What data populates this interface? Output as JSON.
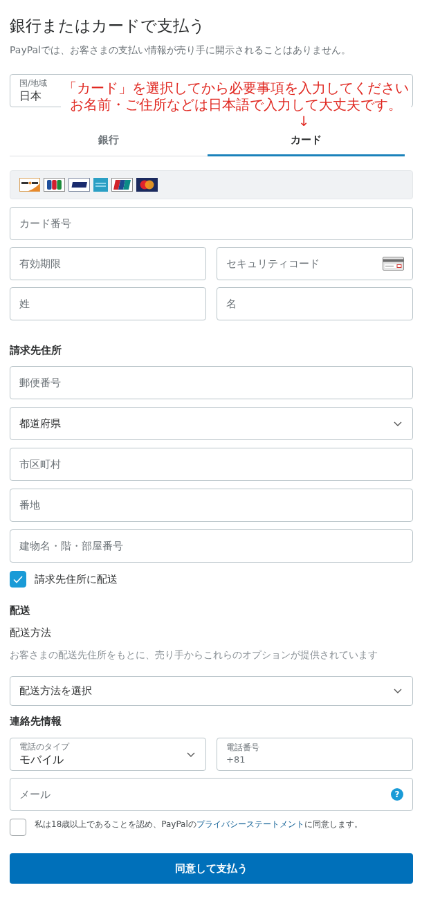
{
  "header": {
    "title": "銀行またはカードで支払う",
    "subtitle": "PayPalでは、お客さまの支払い情報が売り手に開示されることはありません。"
  },
  "country": {
    "label": "国/地域",
    "value": "日本"
  },
  "annotation": {
    "lines": [
      "「カード」を選択してから必要事項を入力してください",
      "お名前・ご住所などは日本語で入力して大丈夫です。"
    ],
    "arrow": "↓"
  },
  "tabs": [
    {
      "label": "銀行",
      "selected": false
    },
    {
      "label": "カード",
      "selected": true
    }
  ],
  "card_form": {
    "rows": [
      [
        {
          "kind": "text",
          "placeholder": "カード番号"
        }
      ],
      [
        {
          "kind": "text",
          "placeholder": "有効期限"
        },
        {
          "kind": "card_code",
          "placeholder": "セキュリティコード"
        }
      ],
      [
        {
          "kind": "text",
          "placeholder": "姓"
        },
        {
          "kind": "text",
          "placeholder": "名"
        }
      ]
    ]
  },
  "billing": {
    "heading": "請求先住所",
    "rows": [
      [
        {
          "kind": "text",
          "placeholder": "郵便番号"
        }
      ],
      [
        {
          "kind": "select",
          "value": "都道府県"
        }
      ],
      [
        {
          "kind": "text",
          "placeholder": "市区町村"
        }
      ],
      [
        {
          "kind": "text",
          "placeholder": "番地"
        }
      ],
      [
        {
          "kind": "text",
          "placeholder": "建物名・階・部屋番号"
        }
      ]
    ],
    "ship_to_billing": {
      "label": "請求先住所に配送",
      "checked": true
    }
  },
  "shipping": {
    "heading": "配送",
    "method_label": "配送方法",
    "hint": "お客さまの配送先住所をもとに、売り手からこれらのオプションが提供されています",
    "select": {
      "kind": "select",
      "value": "配送方法を選択"
    }
  },
  "contact": {
    "heading": "連絡先情報",
    "rows": [
      [
        {
          "kind": "labeled_select",
          "label": "電話のタイプ",
          "value": "モバイル"
        },
        {
          "kind": "labeled_text",
          "label": "電話番号",
          "value": "+81"
        }
      ],
      [
        {
          "kind": "help",
          "placeholder": "メール",
          "help": "?"
        }
      ]
    ]
  },
  "terms": {
    "checked": false,
    "text_before": "私は18歳以上であることを認め、PayPalの",
    "link": "プライバシーステートメント",
    "text_after": "に同意します。"
  },
  "submit": {
    "label": "同意して支払う"
  }
}
